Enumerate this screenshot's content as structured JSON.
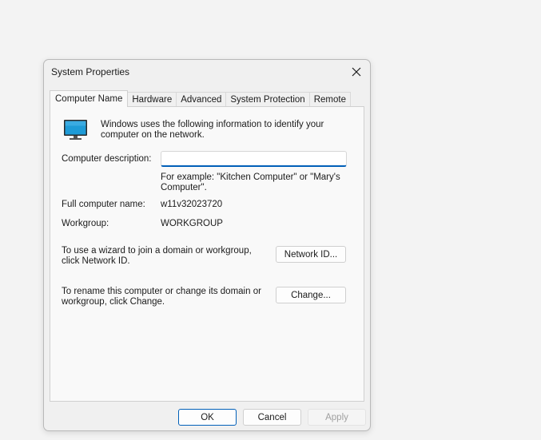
{
  "window": {
    "title": "System Properties",
    "close_icon": "close-icon"
  },
  "tabs": [
    {
      "label": "Computer Name",
      "active": true
    },
    {
      "label": "Hardware",
      "active": false
    },
    {
      "label": "Advanced",
      "active": false
    },
    {
      "label": "System Protection",
      "active": false
    },
    {
      "label": "Remote",
      "active": false
    }
  ],
  "computer_name": {
    "icon": "monitor-icon",
    "intro": "Windows uses the following information to identify your computer on the network.",
    "description_label": "Computer description:",
    "description_value": "",
    "description_placeholder": "",
    "example_text": "For example: \"Kitchen Computer\" or \"Mary's Computer\".",
    "full_name_label": "Full computer name:",
    "full_name_value": "w11v32023720",
    "workgroup_label": "Workgroup:",
    "workgroup_value": "WORKGROUP",
    "network_id_text": "To use a wizard to join a domain or workgroup, click Network ID.",
    "network_id_button": "Network ID...",
    "change_text": "To rename this computer or change its domain or workgroup, click Change.",
    "change_button": "Change..."
  },
  "footer": {
    "ok_label": "OK",
    "cancel_label": "Cancel",
    "apply_label": "Apply",
    "apply_enabled": false
  },
  "colors": {
    "accent": "#005fb8",
    "monitor_screen": "#1e9bd7"
  }
}
